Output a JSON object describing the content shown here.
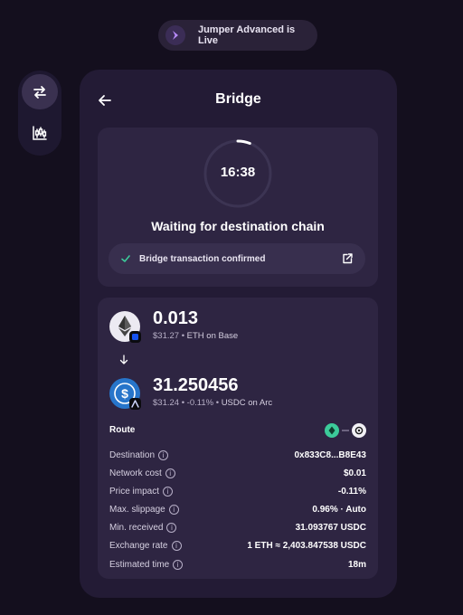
{
  "banner": {
    "text": "Jumper Advanced is Live",
    "logo_icon": "jumper-logo-icon"
  },
  "side_rail": {
    "items": [
      {
        "name": "swap",
        "icon": "swap-arrows-icon",
        "active": true
      },
      {
        "name": "chart",
        "icon": "candlestick-chart-icon",
        "active": false
      }
    ]
  },
  "panel": {
    "title": "Bridge",
    "back_icon": "arrow-left-icon"
  },
  "status": {
    "timer": "16:38",
    "timer_progress": 0.06,
    "title": "Waiting for destination chain",
    "confirmation": "Bridge transaction confirmed"
  },
  "from": {
    "amount": "0.013",
    "usd": "$31.27",
    "sep": "•",
    "label": "ETH on Base",
    "icon": "eth-icon",
    "chain_icon": "base-chain-icon"
  },
  "to": {
    "amount": "31.250456",
    "usd": "$31.24",
    "sep1": "•",
    "change": "-0.11%",
    "sep2": "•",
    "label": "USDC on Arc",
    "icon": "usdc-icon",
    "chain_icon": "arc-chain-icon"
  },
  "route": {
    "label": "Route"
  },
  "details": [
    {
      "label": "Destination",
      "value": "0x833C8...B8E43"
    },
    {
      "label": "Network cost",
      "value": "$0.01"
    },
    {
      "label": "Price impact",
      "value": "-0.11%"
    },
    {
      "label": "Max. slippage",
      "value": "0.96% · Auto"
    },
    {
      "label": "Min. received",
      "value": "31.093767 USDC"
    },
    {
      "label": "Exchange rate",
      "value": "1 ETH ≈ 2,403.847538 USDC"
    },
    {
      "label": "Estimated time",
      "value": "18m"
    }
  ],
  "info_glyph": "i",
  "colors": {
    "background": "#140f1e",
    "panel": "#231b35",
    "card": "#2e2542",
    "accent": "#ffffff",
    "route_green": "#3ccb9a",
    "usdc_blue": "#2775ca"
  }
}
